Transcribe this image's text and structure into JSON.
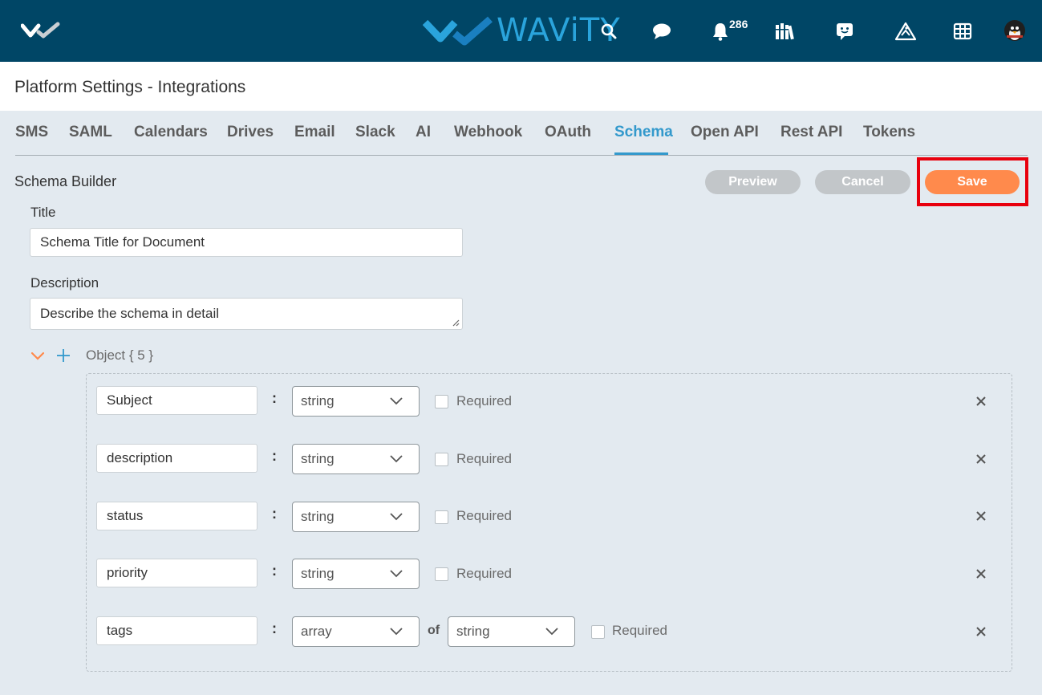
{
  "app": {
    "brand": "WAViTY"
  },
  "topbar": {
    "notification_count": "286",
    "icons": [
      "search-icon",
      "chat-icon",
      "bell-icon",
      "library-icon",
      "feedback-icon",
      "map-icon",
      "grid-icon",
      "avatar"
    ]
  },
  "header": {
    "title": "Platform Settings - Integrations"
  },
  "tabs": [
    {
      "label": "SMS",
      "active": false
    },
    {
      "label": "SAML",
      "active": false
    },
    {
      "label": "Calendars",
      "active": false
    },
    {
      "label": "Drives",
      "active": false
    },
    {
      "label": "Email",
      "active": false
    },
    {
      "label": "Slack",
      "active": false
    },
    {
      "label": "AI",
      "active": false
    },
    {
      "label": "Webhook",
      "active": false
    },
    {
      "label": "OAuth",
      "active": false
    },
    {
      "label": "Schema",
      "active": true
    },
    {
      "label": "Open API",
      "active": false
    },
    {
      "label": "Rest API",
      "active": false
    },
    {
      "label": "Tokens",
      "active": false
    }
  ],
  "builder": {
    "section_title": "Schema Builder",
    "preview_label": "Preview",
    "cancel_label": "Cancel",
    "save_label": "Save",
    "title_label": "Title",
    "title_value": "Schema Title for Document",
    "description_label": "Description",
    "description_value": "Describe the schema in detail",
    "object_label": "Object { 5 }"
  },
  "properties": [
    {
      "name": "Subject",
      "type": "string",
      "required_label": "Required",
      "required": false
    },
    {
      "name": "description",
      "type": "string",
      "required_label": "Required",
      "required": false
    },
    {
      "name": "status",
      "type": "string",
      "required_label": "Required",
      "required": false
    },
    {
      "name": "priority",
      "type": "string",
      "required_label": "Required",
      "required": false
    },
    {
      "name": "tags",
      "type": "array",
      "of_label": "of",
      "item_type": "string",
      "required_label": "Required",
      "required": false
    }
  ],
  "colors": {
    "topbar": "#004666",
    "accent": "#3399cc",
    "save": "#ff8a4c",
    "highlight": "#e8000d"
  }
}
